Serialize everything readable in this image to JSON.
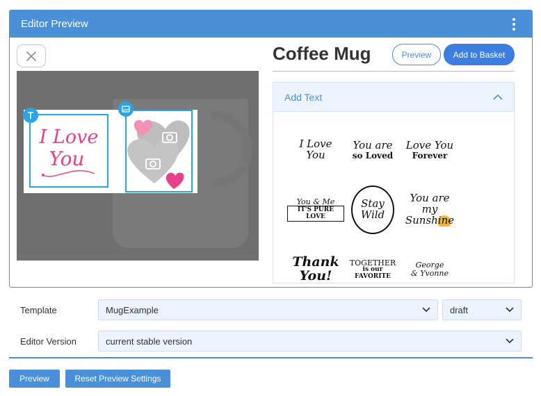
{
  "panel": {
    "title": "Editor Preview"
  },
  "canvas": {
    "frame_text": {
      "line1": "I Love",
      "line2": "You"
    }
  },
  "product": {
    "title": "Coffee Mug",
    "preview_label": "Preview",
    "add_to_basket_label": "Add to Basket"
  },
  "accordion": {
    "title": "Add Text",
    "templates": [
      {
        "line1": "I Love",
        "line2": "You"
      },
      {
        "line1": "You are",
        "line2": "so Loved"
      },
      {
        "line1": "Love You",
        "line2": "Forever"
      },
      {
        "line1": "You & Me",
        "line2": "IT'S PURE LOVE"
      },
      {
        "line1": "Stay",
        "line2": "Wild"
      },
      {
        "line1": "You are my",
        "line2": "Sunshine"
      },
      {
        "line1": "Thank",
        "line2": "You!"
      },
      {
        "line1": "TOGETHER",
        "line2": "is our FAVORITE"
      },
      {
        "line1": "George",
        "line2": "& Yvonne"
      }
    ]
  },
  "form": {
    "template_label": "Template",
    "template_value": "MugExample",
    "status_value": "draft",
    "editor_version_label": "Editor Version",
    "editor_version_value": "current stable version"
  },
  "footer": {
    "preview_label": "Preview",
    "reset_label": "Reset Preview Settings"
  },
  "colors": {
    "accent": "#4a90d9",
    "primary": "#3d7fe0",
    "frame": "#2ba4e6",
    "pink": "#e8418a"
  }
}
